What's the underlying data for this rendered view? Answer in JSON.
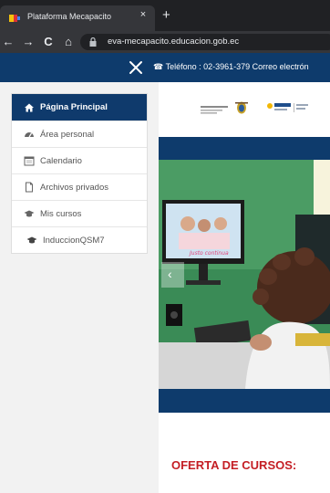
{
  "browser": {
    "tab_title": "Plataforma Mecapacito",
    "tab_close": "×",
    "new_tab": "+",
    "back": "←",
    "forward": "→",
    "reload": "C",
    "home": "⌂",
    "url": "eva-mecapacito.educacion.gob.ec"
  },
  "topbar": {
    "contact": "Teléfono : 02-3961-379  Correo electrón"
  },
  "menu": {
    "items": [
      {
        "label": "Página Principal",
        "icon": "home-icon"
      },
      {
        "label": "Área personal",
        "icon": "dashboard-icon"
      },
      {
        "label": "Calendario",
        "icon": "calendar-icon"
      },
      {
        "label": "Archivos privados",
        "icon": "file-icon"
      },
      {
        "label": "Mis cursos",
        "icon": "graduation-cap-icon"
      },
      {
        "label": "InduccionQSM7",
        "icon": "graduation-cap-icon"
      }
    ]
  },
  "main": {
    "offer_title": "OFERTA DE CURSOS:"
  },
  "colors": {
    "navy": "#0e3b6c",
    "offer_red": "#c41e24"
  }
}
